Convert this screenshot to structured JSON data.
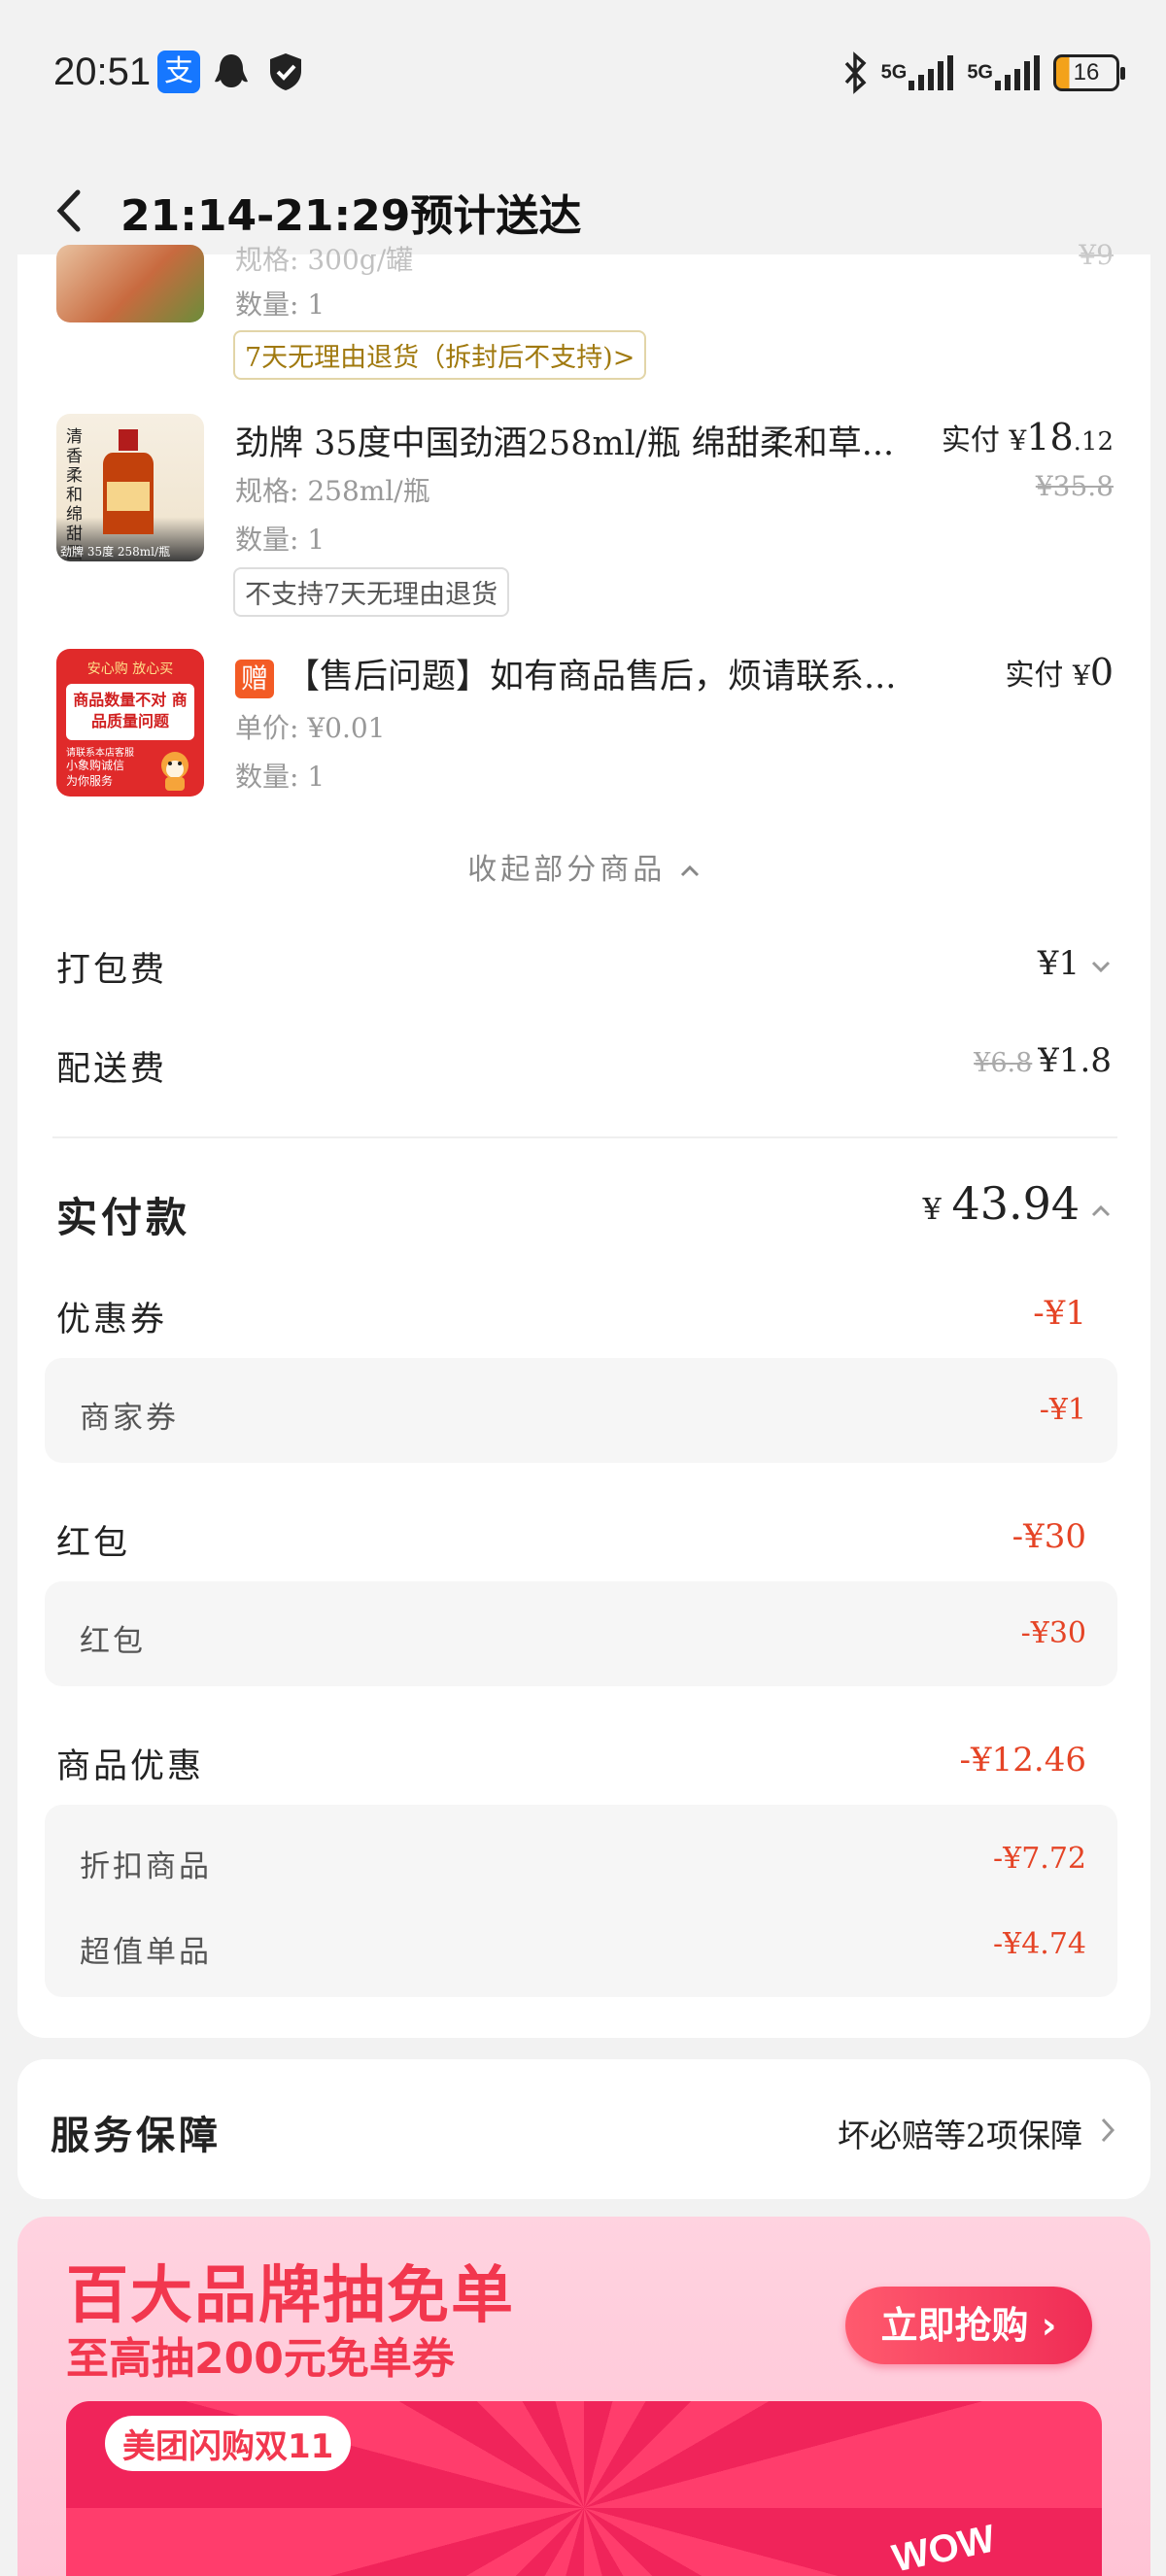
{
  "status": {
    "time": "20:51",
    "alipay_glyph": "支",
    "net1": "5G",
    "net2": "5G",
    "battery": "16"
  },
  "nav": {
    "title": "21:14-21:29预计送达"
  },
  "items": [
    {
      "spec": "规格: 300g/罐",
      "qty": "数量: 1",
      "orig": "¥9",
      "tag": "7天无理由退货（拆封后不支持)>"
    },
    {
      "name": "劲牌 35度中国劲酒258ml/瓶 绵甜柔和草...",
      "spec": "规格: 258ml/瓶",
      "qty": "数量: 1",
      "price_prefix": "实付",
      "price_currency": "¥",
      "price_int": "18",
      "price_dec": ".12",
      "orig": "¥35.8",
      "tag": "不支持7天无理由退货",
      "thumb_text": "清香柔和 绵甜回甘",
      "thumb_label": "劲牌 35度 258ml/瓶"
    },
    {
      "gift": "赠",
      "name": "【售后问题】如有商品售后，烦请联系...",
      "spec": "单价: ¥0.01",
      "qty": "数量: 1",
      "price_prefix": "实付",
      "price_currency": "¥",
      "price_int": "0",
      "thumb_top": "安心购 放心买",
      "thumb_main": "商品数量不对 商品质量问题",
      "thumb_small": "请联系本店客服",
      "thumb_bottom": "小象购诚信 为你服务"
    }
  ],
  "collapse": "收起部分商品",
  "fees": [
    {
      "label": "打包费",
      "value": "¥1"
    },
    {
      "label": "配送费",
      "orig": "¥6.8",
      "value": "¥1.8"
    }
  ],
  "total": {
    "label": "实付款",
    "currency": "¥",
    "value": "43.94"
  },
  "discounts": [
    {
      "label": "优惠券",
      "value": "-¥1",
      "subs": [
        {
          "label": "商家券",
          "value": "-¥1"
        }
      ]
    },
    {
      "label": "红包",
      "value": "-¥30",
      "subs": [
        {
          "label": "红包",
          "value": "-¥30"
        }
      ]
    },
    {
      "label": "商品优惠",
      "value": "-¥12.46",
      "subs": [
        {
          "label": "折扣商品",
          "value": "-¥7.72"
        },
        {
          "label": "超值单品",
          "value": "-¥4.74"
        }
      ]
    }
  ],
  "service": {
    "label": "服务保障",
    "value": "坏必赔等2项保障"
  },
  "banner": {
    "title": "百大品牌抽免单",
    "subtitle": "至高抽200元免单券",
    "button": "立即抢购",
    "logo": "美团闪购双11",
    "wow": "WOW"
  },
  "colors": {
    "accent_red": "#e54426",
    "banner_pink": "#f2374e",
    "background": "#f2f2f2"
  }
}
